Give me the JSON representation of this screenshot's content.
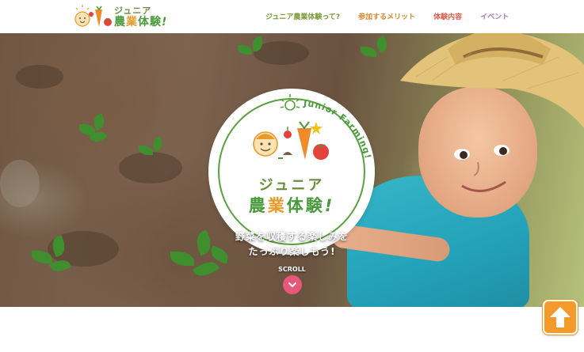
{
  "header": {
    "logo": {
      "top_text": "ジュニア",
      "bottom_text_1": "農",
      "bottom_text_2": "業",
      "bottom_text_3": "体",
      "bottom_text_4": "験",
      "excl": "!"
    },
    "nav": [
      {
        "label": "ジュニア農業体験って?",
        "color": "#7a9a3a"
      },
      {
        "label": "参加するメリット",
        "color": "#d98a2c"
      },
      {
        "label": "体験内容",
        "color": "#e0604f"
      },
      {
        "label": "イベント",
        "color": "#9d7bb5"
      }
    ]
  },
  "hero": {
    "badge": {
      "arc_text": "Junior Farming!",
      "title_top": "ジュニア",
      "title_bottom_1": "農",
      "title_bottom_2": "業",
      "title_bottom_3": "体",
      "title_bottom_4": "験",
      "excl": "!"
    },
    "catch_line_1": "野菜を収穫する楽しみを",
    "catch_line_2": "たっぷり楽しもう!",
    "scroll_label": "SCROLL",
    "scroll_icon": "chevron-down-icon"
  },
  "to_top_icon": "arrow-up-icon",
  "colors": {
    "green": "#4a9a3b",
    "orange": "#e89a2d",
    "pink": "#e8567a",
    "to_top": "#f39a2b"
  }
}
